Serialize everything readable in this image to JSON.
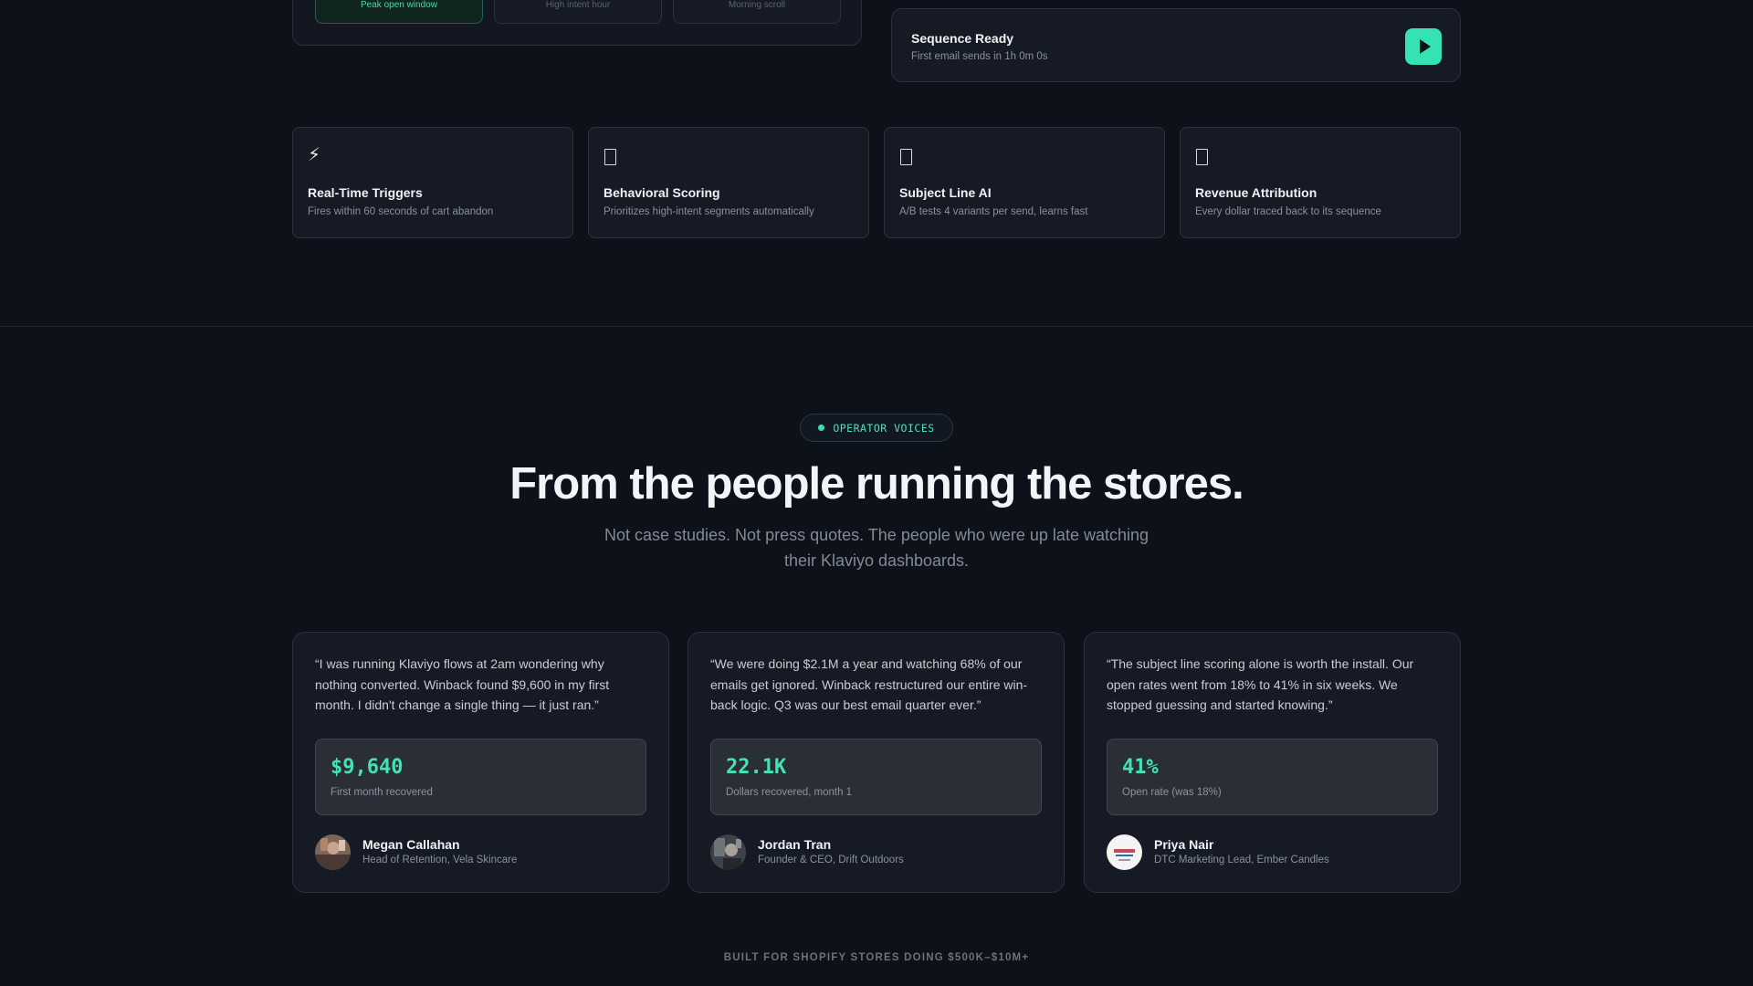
{
  "send_windows": [
    {
      "label": "Peak open window",
      "active": true
    },
    {
      "label": "High intent hour",
      "active": false
    },
    {
      "label": "Morning scroll",
      "active": false
    }
  ],
  "sequence": {
    "title": "Sequence Ready",
    "subtitle": "First email sends in 1h 0m 0s",
    "play_icon": "play-icon"
  },
  "features": [
    {
      "icon": "lightning-icon",
      "title": "Real-Time Triggers",
      "desc": "Fires within 60 seconds of cart abandon"
    },
    {
      "icon": "placeholder-icon",
      "title": "Behavioral Scoring",
      "desc": "Prioritizes high-intent segments automatically"
    },
    {
      "icon": "placeholder-icon",
      "title": "Subject Line AI",
      "desc": "A/B tests 4 variants per send, learns fast"
    },
    {
      "icon": "placeholder-icon",
      "title": "Revenue Attribution",
      "desc": "Every dollar traced back to its sequence"
    }
  ],
  "voices": {
    "badge": "OPERATOR VOICES",
    "headline": "From the people running the stores.",
    "subhead": "Not case studies. Not press quotes. The people who were up late watching their Klaviyo dashboards."
  },
  "testimonials": [
    {
      "quote": "“I was running Klaviyo flows at 2am wondering why nothing converted. Winback found $9,600 in my first month. I didn't change a single thing — it just ran.”",
      "metric_value": "$9,640",
      "metric_label": "First month recovered",
      "name": "Megan Callahan",
      "role": "Head of Retention, Vela Skincare"
    },
    {
      "quote": "“We were doing $2.1M a year and watching 68% of our emails get ignored. Winback restructured our entire win-back logic. Q3 was our best email quarter ever.”",
      "metric_value": "22.1K",
      "metric_label": "Dollars recovered, month 1",
      "name": "Jordan Tran",
      "role": "Founder & CEO, Drift Outdoors"
    },
    {
      "quote": "“The subject line scoring alone is worth the install. Our open rates went from 18% to 41% in six weeks. We stopped guessing and started knowing.”",
      "metric_value": "41%",
      "metric_label": "Open rate (was 18%)",
      "name": "Priya Nair",
      "role": "DTC Marketing Lead, Ember Candles"
    }
  ],
  "footer": {
    "note": "BUILT FOR SHOPIFY STORES DOING $500K–$10M+"
  },
  "colors": {
    "accent": "#36e2b4",
    "background": "#0d111a",
    "card": "#151a24"
  }
}
